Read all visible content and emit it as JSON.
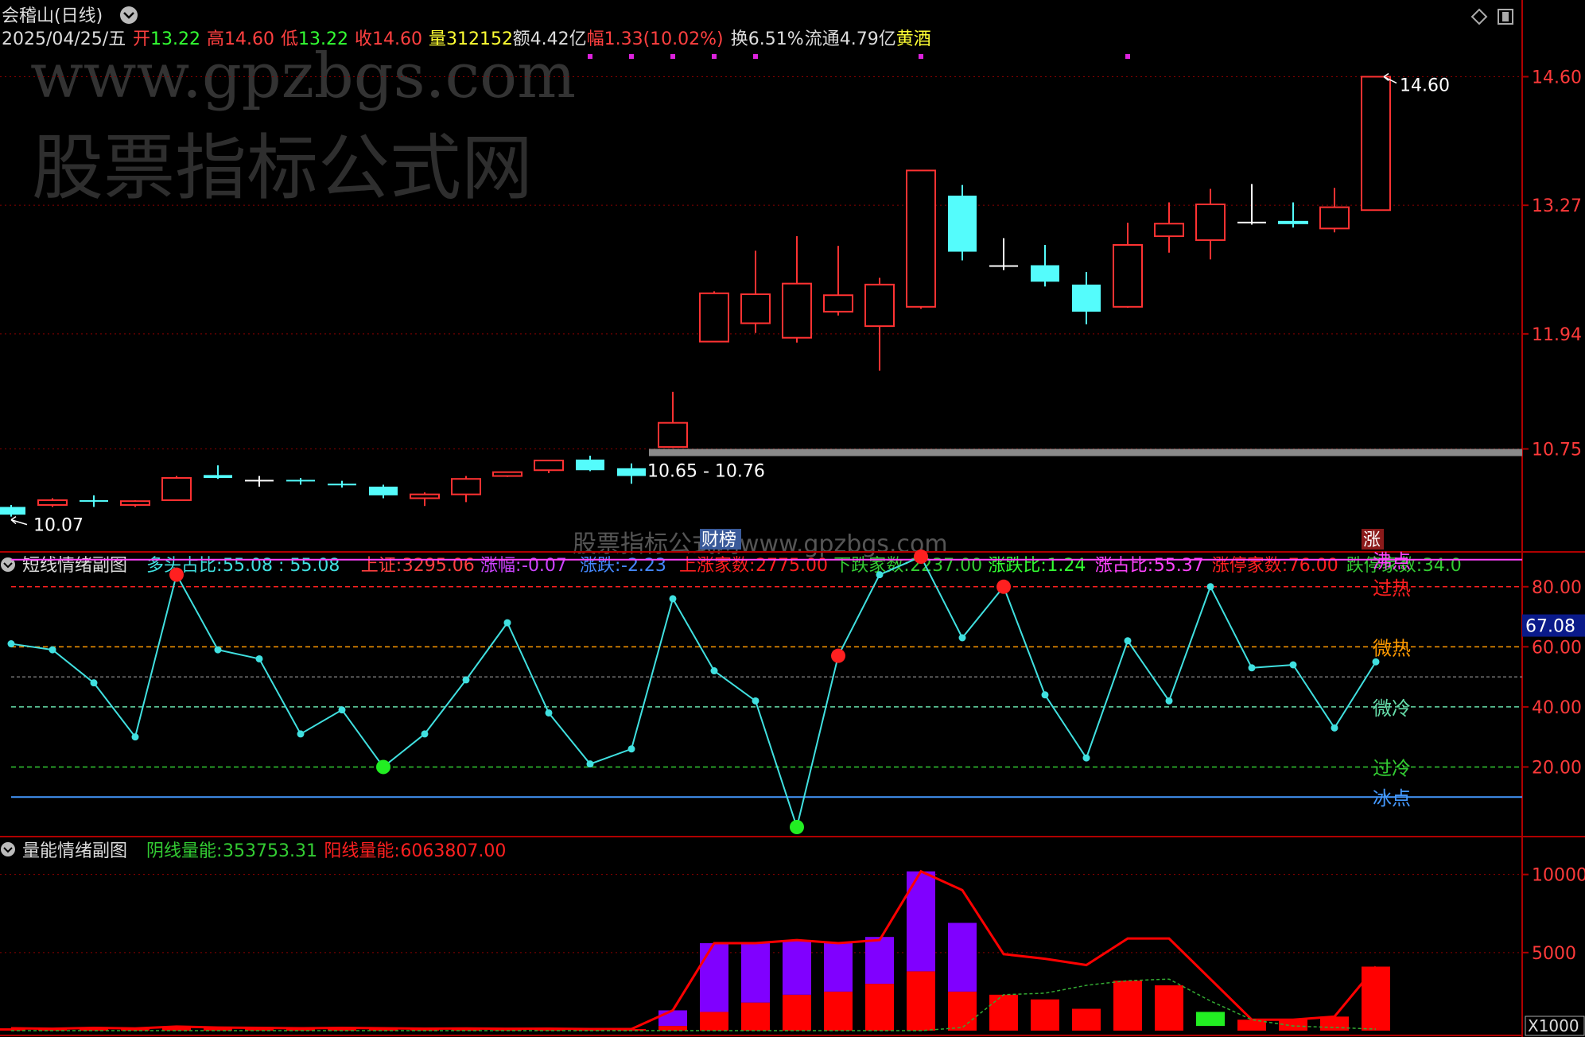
{
  "header": {
    "stock_title": "会稽山(日线)",
    "date": "2025/04/25/五",
    "fields": [
      {
        "label": "开",
        "value": "13.22",
        "label_color": "#ff4040",
        "value_color": "#33ff33"
      },
      {
        "label": "高",
        "value": "14.60",
        "label_color": "#ff4040",
        "value_color": "#ff4040"
      },
      {
        "label": "低",
        "value": "13.22",
        "label_color": "#ff4040",
        "value_color": "#33ff33"
      },
      {
        "label": "收",
        "value": "14.60",
        "label_color": "#ff4040",
        "value_color": "#ff4040"
      },
      {
        "label": "量",
        "value": "312152",
        "label_color": "#ffff33",
        "value_color": "#ffff33"
      },
      {
        "label": "额",
        "value": "4.42亿",
        "label_color": "#dddddd",
        "value_color": "#dddddd"
      },
      {
        "label": "幅",
        "value": "1.33(10.02%)",
        "label_color": "#ff4040",
        "value_color": "#ff4040"
      },
      {
        "label": "换",
        "value": "6.51%",
        "label_color": "#dddddd",
        "value_color": "#dddddd"
      },
      {
        "label": "流通",
        "value": "4.79亿",
        "label_color": "#dddddd",
        "value_color": "#dddddd"
      },
      {
        "label": "黄酒",
        "value": "",
        "label_color": "#ffff33",
        "value_color": "#ffff33"
      }
    ]
  },
  "watermark": {
    "url": "www.gpzbgs.com",
    "cn": "股票指标公式网",
    "bottom": "股票指标公式网www.gpzbgs.com"
  },
  "colors": {
    "up": "#ff3232",
    "down": "#54fcfc",
    "doji": "#ffffff",
    "grid": "#8b0000",
    "bg": "#000000",
    "sentiment_line": "#40e0e0",
    "vol_yang": "#ff0000",
    "vol_yin": "#8000ff"
  },
  "chart_data": [
    {
      "type": "candlestick",
      "name": "main",
      "y_ticks": [
        "14.60",
        "13.27",
        "11.94",
        "10.75"
      ],
      "ylim": [
        9.8,
        14.9
      ],
      "max_label": "14.60",
      "min_label": "10.07",
      "range_label": "10.65 - 10.76",
      "markers": [
        "财榜",
        "涨"
      ],
      "candles": [
        {
          "o": 10.15,
          "h": 10.17,
          "l": 10.05,
          "c": 10.07
        },
        {
          "o": 10.17,
          "h": 10.24,
          "l": 10.15,
          "c": 10.22
        },
        {
          "o": 10.22,
          "h": 10.27,
          "l": 10.15,
          "c": 10.22
        },
        {
          "o": 10.17,
          "h": 10.22,
          "l": 10.15,
          "c": 10.21
        },
        {
          "o": 10.22,
          "h": 10.47,
          "l": 10.22,
          "c": 10.45
        },
        {
          "o": 10.48,
          "h": 10.58,
          "l": 10.44,
          "c": 10.45
        },
        {
          "o": 10.43,
          "h": 10.47,
          "l": 10.36,
          "c": 10.43
        },
        {
          "o": 10.43,
          "h": 10.45,
          "l": 10.38,
          "c": 10.42
        },
        {
          "o": 10.39,
          "h": 10.42,
          "l": 10.35,
          "c": 10.38
        },
        {
          "o": 10.36,
          "h": 10.38,
          "l": 10.24,
          "c": 10.27
        },
        {
          "o": 10.24,
          "h": 10.3,
          "l": 10.16,
          "c": 10.28
        },
        {
          "o": 10.28,
          "h": 10.47,
          "l": 10.2,
          "c": 10.44
        },
        {
          "o": 10.47,
          "h": 10.51,
          "l": 10.46,
          "c": 10.51
        },
        {
          "o": 10.53,
          "h": 10.62,
          "l": 10.5,
          "c": 10.63
        },
        {
          "o": 10.64,
          "h": 10.68,
          "l": 10.52,
          "c": 10.53
        },
        {
          "o": 10.55,
          "h": 10.6,
          "l": 10.39,
          "c": 10.47
        },
        {
          "o": 10.77,
          "h": 11.34,
          "l": 10.76,
          "c": 11.02
        },
        {
          "o": 11.86,
          "h": 12.38,
          "l": 11.86,
          "c": 12.36
        },
        {
          "o": 12.05,
          "h": 12.8,
          "l": 11.95,
          "c": 12.35
        },
        {
          "o": 11.9,
          "h": 12.95,
          "l": 11.85,
          "c": 12.46
        },
        {
          "o": 12.17,
          "h": 12.85,
          "l": 12.13,
          "c": 12.34
        },
        {
          "o": 12.02,
          "h": 12.52,
          "l": 11.56,
          "c": 12.45
        },
        {
          "o": 12.22,
          "h": 13.63,
          "l": 12.2,
          "c": 13.63
        },
        {
          "o": 13.37,
          "h": 13.48,
          "l": 12.7,
          "c": 12.79
        },
        {
          "o": 12.65,
          "h": 12.93,
          "l": 12.6,
          "c": 12.65
        },
        {
          "o": 12.65,
          "h": 12.86,
          "l": 12.43,
          "c": 12.48
        },
        {
          "o": 12.45,
          "h": 12.58,
          "l": 12.04,
          "c": 12.17
        },
        {
          "o": 12.22,
          "h": 13.09,
          "l": 12.21,
          "c": 12.86
        },
        {
          "o": 12.95,
          "h": 13.3,
          "l": 12.78,
          "c": 13.08
        },
        {
          "o": 12.91,
          "h": 13.44,
          "l": 12.71,
          "c": 13.28
        },
        {
          "o": 13.1,
          "h": 13.49,
          "l": 13.07,
          "c": 13.1
        },
        {
          "o": 13.09,
          "h": 13.3,
          "l": 13.04,
          "c": 13.1
        },
        {
          "o": 13.03,
          "h": 13.45,
          "l": 12.99,
          "c": 13.25
        },
        {
          "o": 13.22,
          "h": 14.6,
          "l": 13.22,
          "c": 14.6
        }
      ],
      "support_band": {
        "from_index": 16,
        "value": 10.75
      }
    },
    {
      "type": "line",
      "name": "sentiment",
      "title": "短线情绪副图",
      "indicators": [
        {
          "label": "多头占比:",
          "value": "55.08 : 55.08",
          "color": "#40e0e0"
        },
        {
          "label": "上证:",
          "value": "3295.06",
          "color": "#ff4040"
        },
        {
          "label": "涨幅:",
          "value": "-0.07",
          "color": "#cc44ff"
        },
        {
          "label": "涨跌:",
          "value": "-2.23",
          "color": "#4488ff"
        },
        {
          "label": "上涨家数:",
          "value": "2775.00",
          "color": "#ff2020"
        },
        {
          "label": "下跌家数:",
          "value": "2237.00",
          "color": "#33cc33"
        },
        {
          "label": "涨跌比:",
          "value": "1.24",
          "color": "#33ff33"
        },
        {
          "label": "涨占比:",
          "value": "55.37",
          "color": "#ff44ff"
        },
        {
          "label": "涨停家数:",
          "value": "76.00",
          "color": "#ff2020"
        },
        {
          "label": "跌停家数:",
          "value": "34.0",
          "color": "#33cc33"
        }
      ],
      "y_ticks": [
        "80.00",
        "60.00",
        "40.00",
        "20.00"
      ],
      "ylim": [
        0,
        90
      ],
      "current_value_label": "67.08",
      "zones": [
        {
          "label": "沸点",
          "value": 89,
          "color": "#ff44ff"
        },
        {
          "label": "过热",
          "value": 80,
          "color": "#ff2020"
        },
        {
          "label": "微热",
          "value": 60,
          "color": "#ff9900"
        },
        {
          "label": "微冷",
          "value": 40,
          "color": "#66ddaa"
        },
        {
          "label": "过冷",
          "value": 20,
          "color": "#33cc33"
        },
        {
          "label": "冰点",
          "value": 10,
          "color": "#4499ff"
        }
      ],
      "values": [
        61,
        59,
        48,
        30,
        84,
        59,
        56,
        31,
        39,
        20,
        31,
        49,
        68,
        38,
        21,
        26,
        76,
        52,
        42,
        0,
        57,
        84,
        90,
        63,
        80,
        44,
        23,
        62,
        42,
        80,
        53,
        54,
        33,
        55
      ],
      "red_dots": [
        4,
        20,
        22,
        24
      ],
      "green_dots": [
        9,
        19
      ]
    },
    {
      "type": "bar",
      "name": "volume_sentiment",
      "title": "量能情绪副图",
      "indicators": [
        {
          "label": "阴线量能:",
          "value": "353753.31",
          "color": "#33cc33"
        },
        {
          "label": "阳线量能:",
          "value": "6063807.00",
          "color": "#ff2020"
        }
      ],
      "y_ticks": [
        "10000",
        "5000"
      ],
      "unit_label": "X1000",
      "ylim": [
        0,
        11000
      ],
      "bars": [
        {
          "purple": 0,
          "red": 150
        },
        {
          "purple": 0,
          "red": 120
        },
        {
          "purple": 0,
          "red": 180
        },
        {
          "purple": 0,
          "red": 140
        },
        {
          "purple": 0,
          "red": 260
        },
        {
          "purple": 0,
          "red": 200
        },
        {
          "purple": 0,
          "red": 180
        },
        {
          "purple": 0,
          "red": 150
        },
        {
          "purple": 0,
          "red": 180
        },
        {
          "purple": 0,
          "red": 150
        },
        {
          "purple": 0,
          "red": 130
        },
        {
          "purple": 0,
          "red": 140
        },
        {
          "purple": 0,
          "red": 120
        },
        {
          "purple": 0,
          "red": 130
        },
        {
          "purple": 0,
          "red": 100
        },
        {
          "purple": 0,
          "red": 100
        },
        {
          "purple": 1000,
          "red": 300
        },
        {
          "purple": 4400,
          "red": 1200
        },
        {
          "purple": 3800,
          "red": 1800
        },
        {
          "purple": 3500,
          "red": 2300
        },
        {
          "purple": 3100,
          "red": 2500
        },
        {
          "purple": 3000,
          "red": 3000
        },
        {
          "purple": 6400,
          "red": 3800
        },
        {
          "purple": 4400,
          "red": 2500
        },
        {
          "purple": 0,
          "red": 2300
        },
        {
          "purple": 0,
          "red": 2000
        },
        {
          "purple": 0,
          "red": 1400
        },
        {
          "purple": 0,
          "red": 3200
        },
        {
          "purple": 0,
          "red": 2900
        },
        {
          "purple": 0,
          "green": 900,
          "red": 0
        },
        {
          "purple": 0,
          "red": 700
        },
        {
          "purple": 0,
          "red": 700
        },
        {
          "purple": 0,
          "red": 900
        },
        {
          "purple": 0,
          "red": 4100
        }
      ],
      "red_line": [
        150,
        120,
        180,
        140,
        260,
        200,
        180,
        150,
        180,
        150,
        130,
        140,
        120,
        130,
        100,
        100,
        1300,
        5600,
        5600,
        5800,
        5600,
        5800,
        10200,
        9000,
        4900,
        4600,
        4200,
        5900,
        5900,
        null,
        700,
        700,
        900,
        4100
      ],
      "green_line": [
        0,
        0,
        0,
        0,
        0,
        0,
        0,
        0,
        0,
        0,
        0,
        0,
        0,
        0,
        0,
        0,
        0,
        0,
        0,
        0,
        0,
        0,
        0,
        200,
        2300,
        2400,
        2900,
        3200,
        3300,
        1900,
        700,
        300,
        200,
        100
      ]
    }
  ]
}
